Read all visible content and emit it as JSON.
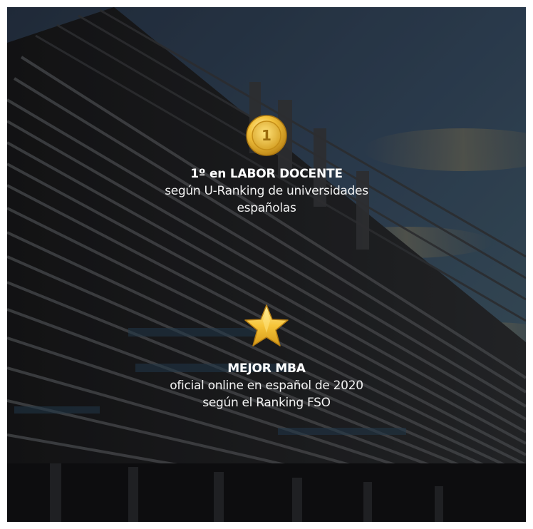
{
  "background": {
    "description_icon": "university-building-photo"
  },
  "awards": [
    {
      "icon": "gold-medal-1-icon",
      "medal_number": "1",
      "title": "1º en LABOR DOCENTE",
      "desc_lines": [
        "según U-Ranking de universidades",
        "españolas"
      ]
    },
    {
      "icon": "gold-star-icon",
      "title": "MEJOR MBA",
      "desc_lines": [
        "oficial online en español de 2020",
        "según el Ranking FSO"
      ]
    }
  ],
  "colors": {
    "text": "#ffffff",
    "gold": "#e8b432",
    "overlay": "#000000"
  }
}
